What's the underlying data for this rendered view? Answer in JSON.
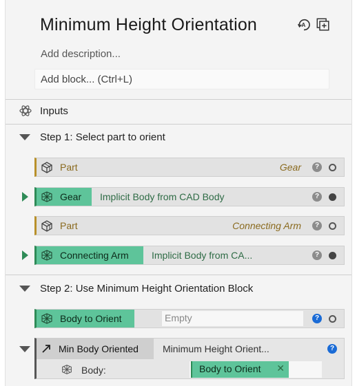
{
  "header": {
    "title": "Minimum Height Orientation",
    "description_placeholder": "Add description...",
    "add_block_placeholder": "Add block... (Ctrl+L)"
  },
  "inputs": {
    "label": "Inputs"
  },
  "step1": {
    "label": "Step 1: Select part to orient",
    "rows": [
      {
        "type": "input",
        "name": "Part",
        "value": "Gear"
      },
      {
        "type": "block",
        "name": "Gear",
        "description": "Implicit Body from CAD Body"
      },
      {
        "type": "input",
        "name": "Part",
        "value": "Connecting Arm"
      },
      {
        "type": "block",
        "name": "Connecting Arm",
        "description": "Implicit Body from CA..."
      }
    ]
  },
  "step2": {
    "label": "Step 2:  Use Minimum Height Orientation Block",
    "body_to_orient": {
      "name": "Body to Orient",
      "value": "Empty"
    },
    "min_body": {
      "name": "Min Body Oriented",
      "description": "Minimum Height Orient...",
      "param_label": "Body:",
      "param_value": "Body to Orient"
    }
  },
  "colors": {
    "green_block": "#5ec49a",
    "green_accent": "#2e8b57",
    "gold_accent": "#b8902a",
    "help_blue": "#1a6bd6"
  },
  "icons": {
    "header": [
      "auto-orient-icon",
      "add-frame-icon"
    ],
    "inputs": "inputs-icon",
    "part": "part-icon",
    "implicit_body": "implicit-body-icon",
    "arrow": "arrow-icon"
  }
}
